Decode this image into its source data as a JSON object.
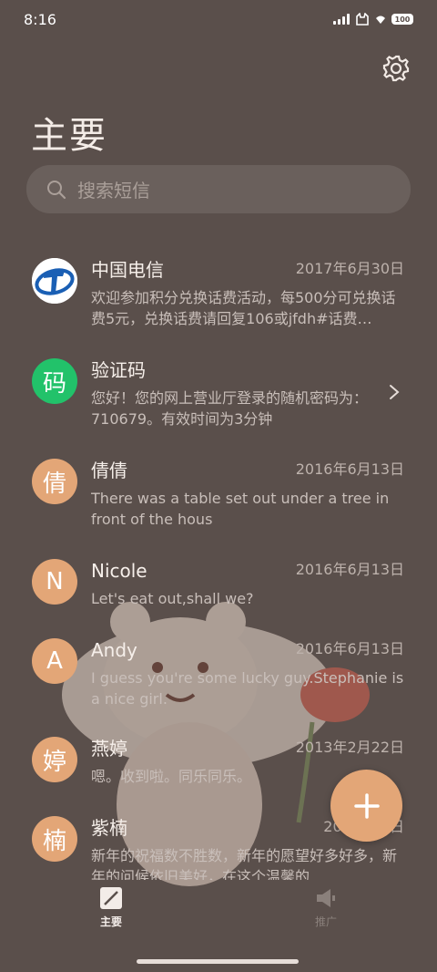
{
  "status_bar": {
    "time": "8:16",
    "battery": "100"
  },
  "header": {
    "title": "主要"
  },
  "search": {
    "placeholder": "搜索短信"
  },
  "threads": [
    {
      "name": "中国电信",
      "date": "2017年6月30日",
      "preview": "欢迎参加积分兑换话费活动，每500分可兑换话费5元，兑换话费请回复106或jfdh#话费…",
      "avatar": "",
      "avatar_color": "#ffffff"
    },
    {
      "name": "验证码",
      "date": "",
      "preview": "您好！您的网上营业厅登录的随机密码为：710679。有效时间为3分钟",
      "avatar": "码",
      "avatar_color": "#22c26a"
    },
    {
      "name": "倩倩",
      "date": "2016年6月13日",
      "preview": "There was a table set out under a tree in front of the hous",
      "avatar": "倩",
      "avatar_color": "#e3a677"
    },
    {
      "name": "Nicole",
      "date": "2016年6月13日",
      "preview": "Let's eat out,shall we?",
      "avatar": "N",
      "avatar_color": "#e3a677"
    },
    {
      "name": "Andy",
      "date": "2016年6月13日",
      "preview": "I guess you're some lucky guy.Stephanie is a nice girl.",
      "avatar": "A",
      "avatar_color": "#e3a677"
    },
    {
      "name": "燕婷",
      "date": "2013年2月22日",
      "preview": "嗯。收到啦。同乐同乐。",
      "avatar": "婷",
      "avatar_color": "#e3a677"
    },
    {
      "name": "紫楠",
      "date": "2013年…日",
      "preview": "新年的祝福数不胜数，新年的愿望好多好多，新年的问候依旧美好，在这个温馨的…",
      "avatar": "楠",
      "avatar_color": "#e3a677"
    }
  ],
  "bottom_nav": {
    "items": [
      {
        "label": "主要",
        "active": true
      },
      {
        "label": "推广",
        "active": false
      }
    ]
  },
  "colors": {
    "background": "#5a4f4b",
    "accent": "#e3a677",
    "verify_green": "#22c26a"
  },
  "icons": {
    "settings": "gear-icon",
    "search": "search-icon",
    "compose": "plus-icon"
  }
}
